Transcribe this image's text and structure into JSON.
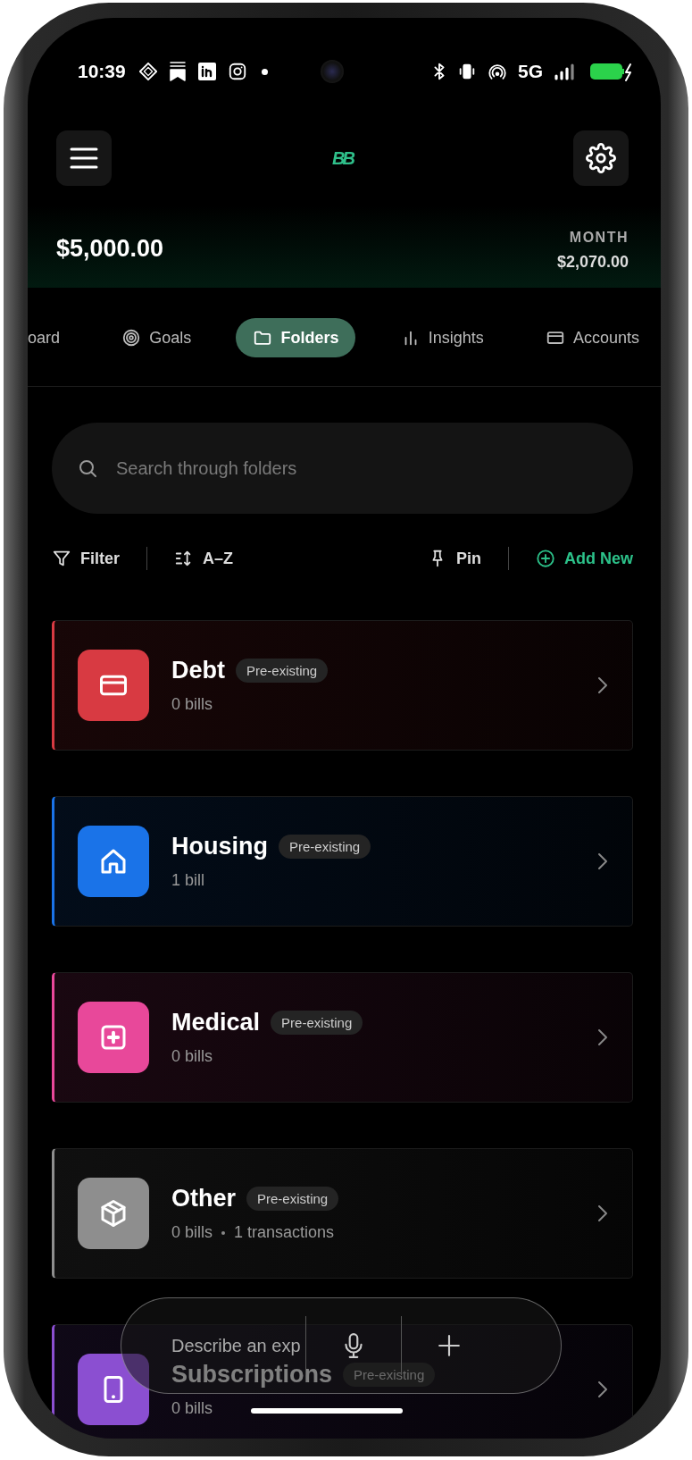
{
  "status_bar": {
    "time": "10:39",
    "network": "5G"
  },
  "header": {
    "logo": "BB"
  },
  "balance": {
    "amount": "$5,000.00",
    "period_label": "MONTH",
    "period_amount": "$2,070.00"
  },
  "tabs": [
    {
      "label": "oard",
      "selected": false
    },
    {
      "label": "Goals",
      "selected": false
    },
    {
      "label": "Folders",
      "selected": true
    },
    {
      "label": "Insights",
      "selected": false
    },
    {
      "label": "Accounts",
      "selected": false
    }
  ],
  "search": {
    "placeholder": "Search through folders"
  },
  "toolbar": {
    "filter": "Filter",
    "sort": "A–Z",
    "pin": "Pin",
    "add": "Add New"
  },
  "folders": [
    {
      "name": "Debt",
      "badge": "Pre-existing",
      "meta": [
        "0 bills"
      ],
      "color": "#d83a42"
    },
    {
      "name": "Housing",
      "badge": "Pre-existing",
      "meta": [
        "1 bill"
      ],
      "color": "#1a73e8"
    },
    {
      "name": "Medical",
      "badge": "Pre-existing",
      "meta": [
        "0 bills"
      ],
      "color": "#e8489a"
    },
    {
      "name": "Other",
      "badge": "Pre-existing",
      "meta": [
        "0 bills",
        "1 transactions"
      ],
      "color": "#8e8e8e"
    },
    {
      "name": "Subscriptions",
      "badge": "Pre-existing",
      "meta": [
        "0 bills"
      ],
      "color": "#8b4fd1"
    }
  ],
  "composer": {
    "placeholder": "Describe an exp"
  }
}
